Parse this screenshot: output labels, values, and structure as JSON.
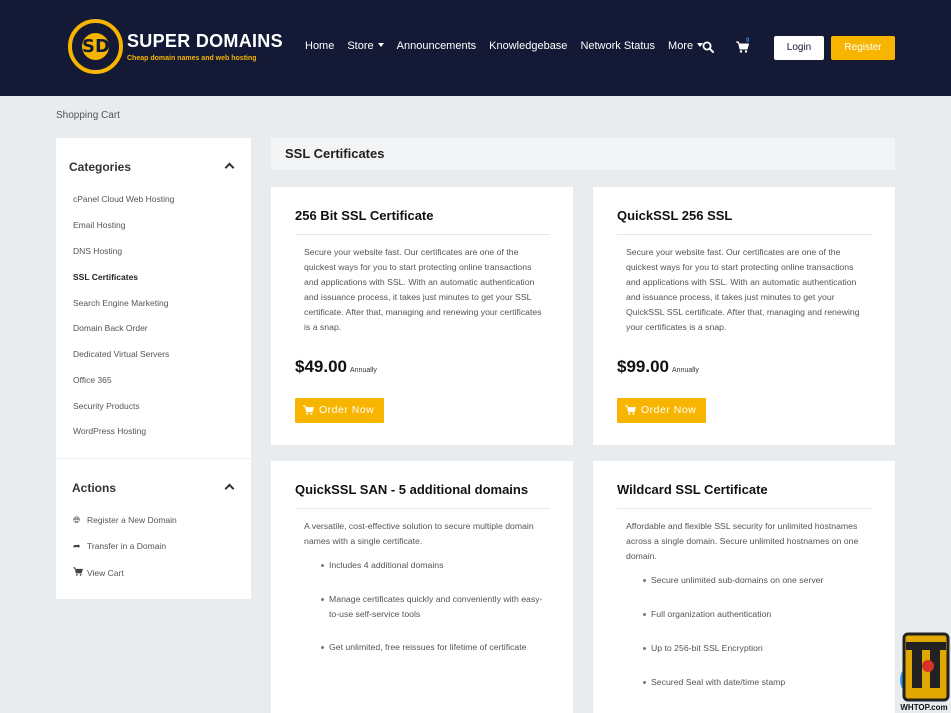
{
  "brand": {
    "name": "SUPER DOMAINS",
    "tagline": "Cheap domain names and web hosting",
    "monogram": "SD",
    "colors": {
      "header_bg": "#141a36",
      "accent": "#f7b500",
      "badge": "#2a9cf5"
    }
  },
  "nav": {
    "items": [
      "Home",
      "Store",
      "Announcements",
      "Knowledgebase",
      "Network Status",
      "More"
    ],
    "cart_count": "0",
    "login_label": "Login",
    "register_label": "Register",
    "icons": [
      "search-icon",
      "cart-icon"
    ]
  },
  "breadcrumb": "Shopping Cart",
  "sidebar": {
    "categories_title": "Categories",
    "categories": [
      "cPanel Cloud Web Hosting",
      "Email Hosting",
      "DNS Hosting",
      "SSL Certificates",
      "Search Engine Marketing",
      "Domain Back Order",
      "Dedicated Virtual Servers",
      "Office 365",
      "Security Products",
      "WordPress Hosting"
    ],
    "active_category": "SSL Certificates",
    "actions_title": "Actions",
    "actions": [
      {
        "label": "Register a New Domain",
        "icon": "globe-icon"
      },
      {
        "label": "Transfer in a Domain",
        "icon": "share-arrow-icon"
      },
      {
        "label": "View Cart",
        "icon": "cart-icon"
      }
    ]
  },
  "main": {
    "section_title": "SSL Certificates",
    "products": [
      {
        "name": "256 Bit SSL Certificate",
        "description": "Secure your website fast. Our certificates are one of the quickest ways for you to start protecting online transactions and applications with SSL. With an automatic authentication and issuance process, it takes just minutes to get your SSL certificate. After that, managing and renewing your certificates is a snap.",
        "price": "$49.00",
        "cycle": "Annually",
        "order_label": "Order Now"
      },
      {
        "name": "QuickSSL 256 SSL",
        "description": "Secure your website fast. Our certificates are one of the quickest ways for you to start protecting online transactions and applications with SSL. With an automatic authentication and issuance process, it takes just minutes to get your QuickSSL SSL certificate. After that, managing and renewing your certificates is a snap.",
        "price": "$99.00",
        "cycle": "Annually",
        "order_label": "Order Now"
      },
      {
        "name": "QuickSSL SAN - 5 additional domains",
        "description": "A versatile, cost-effective solution to secure multiple domain names with a single certificate.",
        "features": [
          "Includes 4 additional domains",
          "Manage certificates quickly and conveniently with easy-to-use self-service tools",
          "Get unlimited, free reissues for lifetime of certificate"
        ]
      },
      {
        "name": "Wildcard SSL Certificate",
        "description": "Affordable and flexible SSL security for unlimited hostnames across a single domain.  Secure unlimited hostnames on one domain.",
        "features": [
          "Secure unlimited sub-domains on one server",
          "Full organization authentication",
          "Up to 256-bit SSL Encryption",
          "Secured Seal with date/time stamp"
        ]
      }
    ]
  },
  "watermark": "WHTOP.com"
}
